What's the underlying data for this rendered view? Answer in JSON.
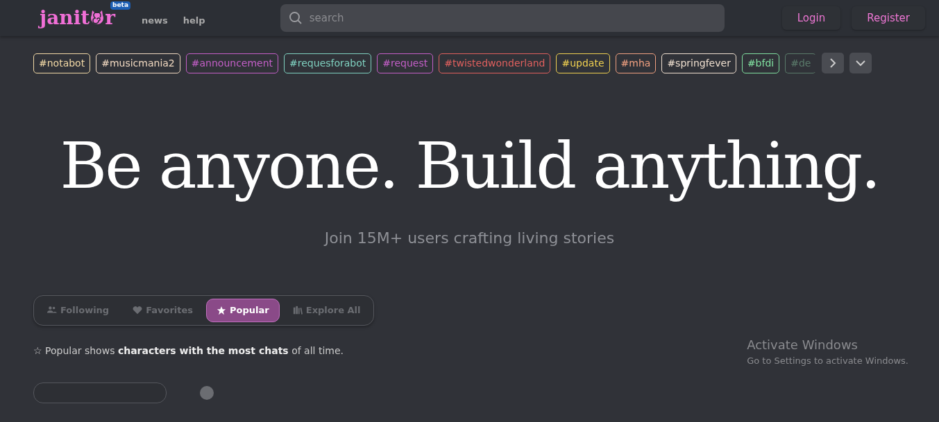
{
  "header": {
    "logo": {
      "before": "janit",
      "after": "r",
      "badge": "beta"
    },
    "nav_links": [
      "news",
      "help"
    ],
    "search": {
      "placeholder": "search"
    },
    "auth_buttons": [
      "Login",
      "Register"
    ]
  },
  "tags": [
    {
      "label": "#notabot",
      "color": "#f2d9a6"
    },
    {
      "label": "#musicmania2",
      "color": "#f0d8c0"
    },
    {
      "label": "#announcement",
      "color": "#c45fc8"
    },
    {
      "label": "#requesforabot",
      "color": "#7fd1c0"
    },
    {
      "label": "#request",
      "color": "#c45fc8"
    },
    {
      "label": "#twistedwonderland",
      "color": "#e0605e"
    },
    {
      "label": "#update",
      "color": "#f0d050"
    },
    {
      "label": "#mha",
      "color": "#f0a080"
    },
    {
      "label": "#springfever",
      "color": "#f0e0d0"
    },
    {
      "label": "#bfdi",
      "color": "#80e0a0"
    },
    {
      "label": "#de",
      "color": "#5a7a6a"
    }
  ],
  "hero": {
    "title": "Be anyone. Build anything.",
    "subtitle": "Join 15M+ users crafting living stories"
  },
  "filter_tabs": [
    {
      "label": "Following",
      "selected": false
    },
    {
      "label": "Favorites",
      "selected": false
    },
    {
      "label": "Popular",
      "selected": true
    },
    {
      "label": "Explore All",
      "selected": false
    }
  ],
  "description": "☆ Popular shows **characters with the most chats** of all time.",
  "os_notice": {
    "title": "Activate Windows",
    "text": "Go to Settings to activate Windows."
  }
}
